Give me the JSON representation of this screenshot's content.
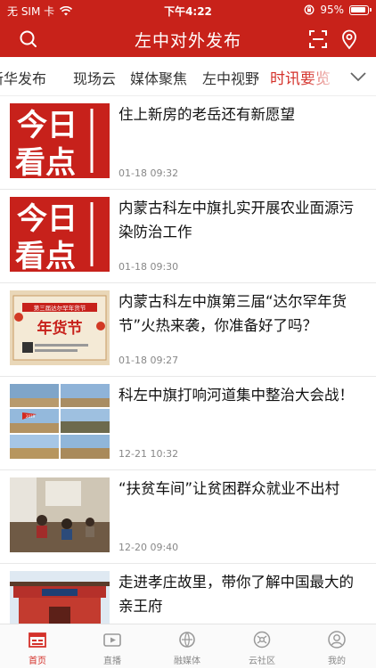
{
  "status_bar": {
    "carrier": "无 SIM 卡",
    "time": "下午4:22",
    "battery": "95%"
  },
  "header": {
    "title": "左中对外发布",
    "icons": [
      "search-icon",
      "scan-icon",
      "location-icon"
    ]
  },
  "tabs": [
    {
      "label": "新华发布",
      "active": false
    },
    {
      "label": "现场云",
      "active": false
    },
    {
      "label": "媒体聚焦",
      "active": false
    },
    {
      "label": "左中视野",
      "active": false
    },
    {
      "label": "时讯要览",
      "active": true
    }
  ],
  "thumb_text": {
    "jinri_line1": "今日",
    "jinri_line2": "看点",
    "nianhuo_banner": "第三届达尔罕年货节",
    "nianhuo_title": "年货节",
    "photo_flag": "2019"
  },
  "news": [
    {
      "title": "住上新房的老岳还有新愿望",
      "time": "01-18 09:32",
      "thumb": "jinri"
    },
    {
      "title": "内蒙古科左中旗扎实开展农业面源污染防治工作",
      "time": "01-18 09:30",
      "thumb": "jinri"
    },
    {
      "title": "内蒙古科左中旗第三届“达尔罕年货节”火热来袭，你准备好了吗？",
      "time": "01-18 09:27",
      "thumb": "nianhuo"
    },
    {
      "title": "科左中旗打响河道集中整治大会战！",
      "time": "12-21 10:32",
      "thumb": "photo-grid"
    },
    {
      "title": "“扶贫车间”让贫困群众就业不出村",
      "time": "12-20 09:40",
      "thumb": "workshop"
    },
    {
      "title": "走进孝庄故里，带你了解中国最大的亲王府",
      "time": "",
      "thumb": "gate"
    }
  ],
  "bottom_nav": [
    {
      "label": "首页",
      "icon": "home-icon",
      "active": true
    },
    {
      "label": "直播",
      "icon": "live-icon",
      "active": false
    },
    {
      "label": "融媒体",
      "icon": "media-icon",
      "active": false
    },
    {
      "label": "云社区",
      "icon": "community-icon",
      "active": false
    },
    {
      "label": "我的",
      "icon": "profile-icon",
      "active": false
    }
  ],
  "colors": {
    "brand_red": "#c8221a",
    "active_tab": "#d4312a",
    "text": "#111111",
    "muted": "#888888"
  }
}
